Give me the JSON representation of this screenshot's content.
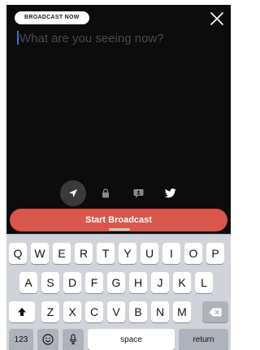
{
  "badge": "BROADCAST NOW",
  "prompt": {
    "placeholder": "What are you seeing now?"
  },
  "icons": {
    "close": "close-icon",
    "location": "location-arrow-icon",
    "lock": "lock-icon",
    "chat": "chat-icon",
    "twitter": "twitter-icon"
  },
  "start_button": "Start Broadcast",
  "keyboard": {
    "row1": [
      "Q",
      "W",
      "E",
      "R",
      "T",
      "Y",
      "U",
      "I",
      "O",
      "P"
    ],
    "row2": [
      "A",
      "S",
      "D",
      "F",
      "G",
      "H",
      "J",
      "K",
      "L"
    ],
    "row3": [
      "Z",
      "X",
      "C",
      "V",
      "B",
      "N",
      "M"
    ],
    "numbers": "123",
    "space": "space",
    "return": "return"
  },
  "colors": {
    "accent": "#d9564a",
    "camera_bg": "#0c0c0c",
    "keyboard_bg": "#d0d3d9"
  }
}
